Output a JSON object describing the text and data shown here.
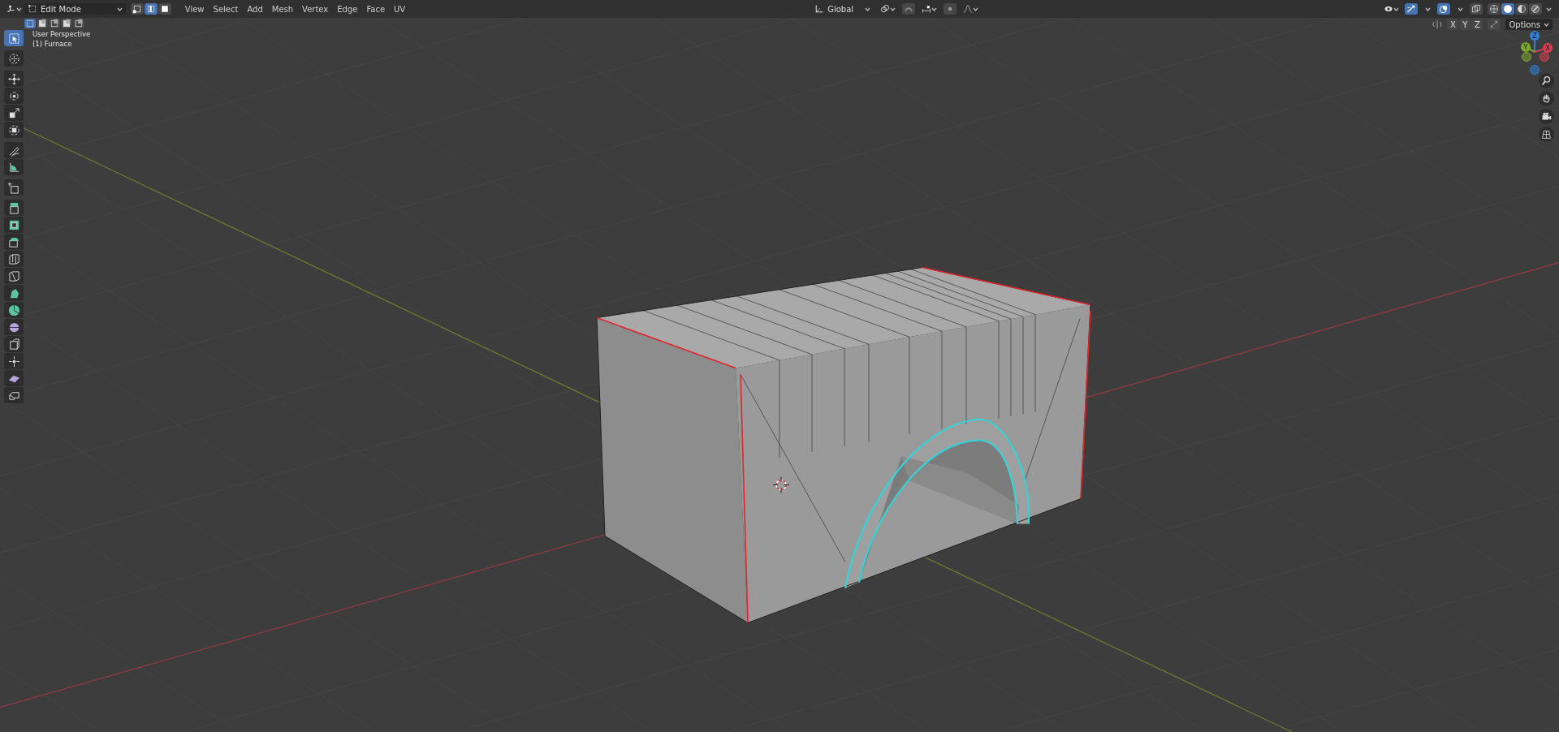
{
  "header": {
    "editor_type": {
      "kind": "view3d"
    },
    "mode": {
      "label": "Edit Mode"
    },
    "select_modes": [
      {
        "kind": "vertex",
        "selected": false
      },
      {
        "kind": "edge",
        "selected": true
      },
      {
        "kind": "face",
        "selected": false
      }
    ],
    "menus": [
      "View",
      "Select",
      "Add",
      "Mesh",
      "Vertex",
      "Edge",
      "Face",
      "UV"
    ],
    "orientation": {
      "label": "Global"
    },
    "gizmos_on": true,
    "overlays_on": true,
    "xray_on": false,
    "shading": [
      {
        "kind": "wireframe",
        "selected": false
      },
      {
        "kind": "solid",
        "selected": true
      },
      {
        "kind": "material",
        "selected": false
      },
      {
        "kind": "rendered",
        "selected": false
      }
    ]
  },
  "tool_settings": {
    "box_modes": [
      {
        "selected": true
      },
      {
        "selected": false
      },
      {
        "selected": false
      },
      {
        "selected": false
      },
      {
        "selected": false
      }
    ],
    "mirror_axes": [
      {
        "label": "X",
        "on": false
      },
      {
        "label": "Y",
        "on": false
      },
      {
        "label": "Z",
        "on": false
      }
    ],
    "options": "Options"
  },
  "viewport": {
    "view_name": "User Perspective",
    "object_label": "(1) Furnace"
  },
  "toolbar": {
    "tools": [
      {
        "kind": "select",
        "selected": true
      },
      {
        "kind": "cursor",
        "selected": false
      },
      {
        "kind": "move",
        "selected": false
      },
      {
        "kind": "rotate",
        "selected": false
      },
      {
        "kind": "scale",
        "selected": false
      },
      {
        "kind": "transform",
        "selected": false
      },
      {
        "kind": "annotate",
        "selected": false
      },
      {
        "kind": "measure",
        "selected": false
      },
      {
        "kind": "add_cube",
        "selected": false
      },
      {
        "kind": "extrude",
        "selected": false
      },
      {
        "kind": "inset",
        "selected": false
      },
      {
        "kind": "bevel",
        "selected": false
      },
      {
        "kind": "loop_cut",
        "selected": false
      },
      {
        "kind": "knife",
        "selected": false
      },
      {
        "kind": "poly_build",
        "selected": false
      },
      {
        "kind": "spin",
        "selected": false
      },
      {
        "kind": "smooth",
        "selected": false
      },
      {
        "kind": "edge_slide",
        "selected": false
      },
      {
        "kind": "shrink",
        "selected": false
      },
      {
        "kind": "shear",
        "selected": false
      },
      {
        "kind": "rip",
        "selected": false
      }
    ]
  },
  "gizmo": {
    "axes": [
      {
        "label": "Z",
        "color": "#2f7fd6"
      },
      {
        "label": "Y",
        "color": "#7ca82e"
      },
      {
        "label": "X",
        "color": "#d3404f"
      }
    ]
  },
  "navigation": [
    {
      "kind": "zoom"
    },
    {
      "kind": "pan"
    },
    {
      "kind": "camera"
    },
    {
      "kind": "ortho"
    }
  ]
}
